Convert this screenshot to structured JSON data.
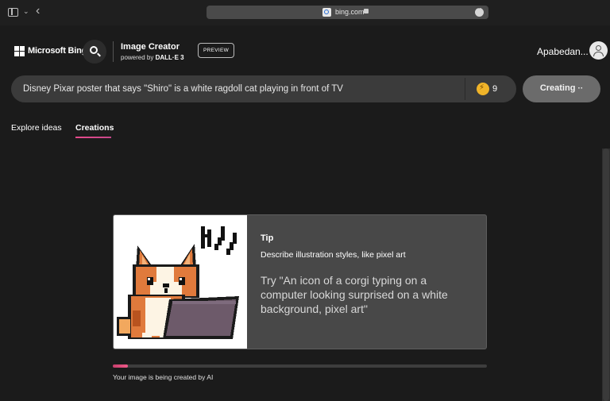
{
  "browser": {
    "url": "bing.com",
    "icons": [
      "sidebar-toggle-icon",
      "chevron-down-icon",
      "back-arrow-icon",
      "site-favicon-icon",
      "lock-icon",
      "more-options-icon"
    ]
  },
  "header": {
    "brand": "Microsoft Bing",
    "app_title": "Image Creator",
    "app_subtitle_prefix": "powered by",
    "app_subtitle_model": "DALL·E 3",
    "preview_badge": "PREVIEW",
    "user_name": "Apabedan..."
  },
  "prompt": {
    "text": "Disney Pixar poster that says \"Shiro\" is a white ragdoll cat playing in front of TV",
    "boosts": "9",
    "create_label": "Creating",
    "create_dots": "··"
  },
  "tabs": [
    {
      "label": "Explore ideas",
      "active": false
    },
    {
      "label": "Creations",
      "active": true
    }
  ],
  "tip": {
    "title": "Tip",
    "description": "Describe illustration styles, like pixel art",
    "example": "Try \"An icon of a corgi typing on a computer looking surprised on a white background, pixel art\""
  },
  "progress": {
    "fraction": 0.04,
    "label": "Your image is being created by AI"
  },
  "colors": {
    "background": "#1b1b1b",
    "accent": "#e64a8b",
    "boost": "#f0b429"
  }
}
